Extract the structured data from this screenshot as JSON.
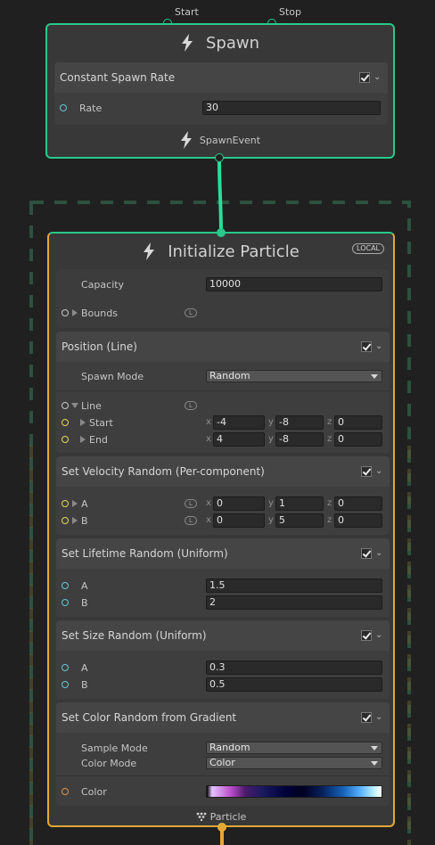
{
  "spawn": {
    "flow_in": [
      "Start",
      "Stop"
    ],
    "title": "Spawn",
    "block": {
      "title": "Constant Spawn Rate",
      "rate_label": "Rate",
      "rate_value": "30"
    },
    "output_event": "SpawnEvent"
  },
  "init": {
    "title": "Initialize Particle",
    "space_badge": "LOCAL",
    "capacity_label": "Capacity",
    "capacity_value": "10000",
    "bounds_label": "Bounds",
    "blocks": {
      "position": {
        "title": "Position (Line)",
        "spawn_mode_label": "Spawn Mode",
        "spawn_mode_value": "Random",
        "line_label": "Line",
        "start_label": "Start",
        "start": {
          "x": "-4",
          "y": "-8",
          "z": "0"
        },
        "end_label": "End",
        "end": {
          "x": "4",
          "y": "-8",
          "z": "0"
        }
      },
      "velocity": {
        "title": "Set Velocity Random (Per-component)",
        "a_label": "A",
        "a": {
          "x": "0",
          "y": "1",
          "z": "0"
        },
        "b_label": "B",
        "b": {
          "x": "0",
          "y": "5",
          "z": "0"
        }
      },
      "lifetime": {
        "title": "Set Lifetime Random (Uniform)",
        "a_label": "A",
        "a": "1.5",
        "b_label": "B",
        "b": "2"
      },
      "size": {
        "title": "Set Size Random (Uniform)",
        "a_label": "A",
        "a": "0.3",
        "b_label": "B",
        "b": "0.5"
      },
      "color": {
        "title": "Set Color Random from Gradient",
        "sample_mode_label": "Sample Mode",
        "sample_mode_value": "Random",
        "color_mode_label": "Color Mode",
        "color_mode_value": "Color",
        "color_label": "Color"
      }
    },
    "output": "Particle"
  },
  "axis_labels": {
    "x": "x",
    "y": "y",
    "z": "z"
  },
  "local_marker": "L",
  "colors": {
    "spawn_border": "#27c98c",
    "particle_border": "#e6a734",
    "background": "#202020"
  },
  "icons": [
    "bolt-icon",
    "checkbox-icon",
    "chevron-down-icon",
    "particle-icon"
  ]
}
